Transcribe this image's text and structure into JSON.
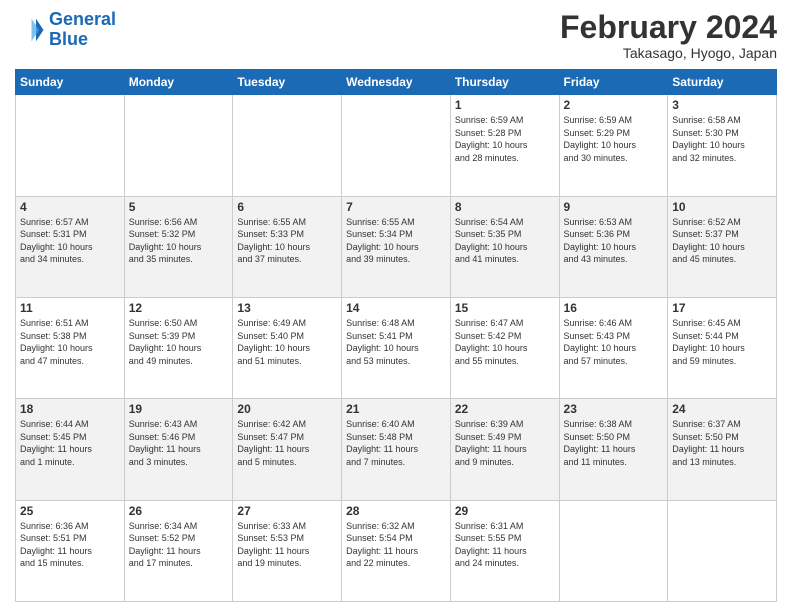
{
  "header": {
    "logo_line1": "General",
    "logo_line2": "Blue",
    "month_title": "February 2024",
    "location": "Takasago, Hyogo, Japan"
  },
  "days_of_week": [
    "Sunday",
    "Monday",
    "Tuesday",
    "Wednesday",
    "Thursday",
    "Friday",
    "Saturday"
  ],
  "weeks": [
    [
      {
        "day": "",
        "info": ""
      },
      {
        "day": "",
        "info": ""
      },
      {
        "day": "",
        "info": ""
      },
      {
        "day": "",
        "info": ""
      },
      {
        "day": "1",
        "info": "Sunrise: 6:59 AM\nSunset: 5:28 PM\nDaylight: 10 hours\nand 28 minutes."
      },
      {
        "day": "2",
        "info": "Sunrise: 6:59 AM\nSunset: 5:29 PM\nDaylight: 10 hours\nand 30 minutes."
      },
      {
        "day": "3",
        "info": "Sunrise: 6:58 AM\nSunset: 5:30 PM\nDaylight: 10 hours\nand 32 minutes."
      }
    ],
    [
      {
        "day": "4",
        "info": "Sunrise: 6:57 AM\nSunset: 5:31 PM\nDaylight: 10 hours\nand 34 minutes."
      },
      {
        "day": "5",
        "info": "Sunrise: 6:56 AM\nSunset: 5:32 PM\nDaylight: 10 hours\nand 35 minutes."
      },
      {
        "day": "6",
        "info": "Sunrise: 6:55 AM\nSunset: 5:33 PM\nDaylight: 10 hours\nand 37 minutes."
      },
      {
        "day": "7",
        "info": "Sunrise: 6:55 AM\nSunset: 5:34 PM\nDaylight: 10 hours\nand 39 minutes."
      },
      {
        "day": "8",
        "info": "Sunrise: 6:54 AM\nSunset: 5:35 PM\nDaylight: 10 hours\nand 41 minutes."
      },
      {
        "day": "9",
        "info": "Sunrise: 6:53 AM\nSunset: 5:36 PM\nDaylight: 10 hours\nand 43 minutes."
      },
      {
        "day": "10",
        "info": "Sunrise: 6:52 AM\nSunset: 5:37 PM\nDaylight: 10 hours\nand 45 minutes."
      }
    ],
    [
      {
        "day": "11",
        "info": "Sunrise: 6:51 AM\nSunset: 5:38 PM\nDaylight: 10 hours\nand 47 minutes."
      },
      {
        "day": "12",
        "info": "Sunrise: 6:50 AM\nSunset: 5:39 PM\nDaylight: 10 hours\nand 49 minutes."
      },
      {
        "day": "13",
        "info": "Sunrise: 6:49 AM\nSunset: 5:40 PM\nDaylight: 10 hours\nand 51 minutes."
      },
      {
        "day": "14",
        "info": "Sunrise: 6:48 AM\nSunset: 5:41 PM\nDaylight: 10 hours\nand 53 minutes."
      },
      {
        "day": "15",
        "info": "Sunrise: 6:47 AM\nSunset: 5:42 PM\nDaylight: 10 hours\nand 55 minutes."
      },
      {
        "day": "16",
        "info": "Sunrise: 6:46 AM\nSunset: 5:43 PM\nDaylight: 10 hours\nand 57 minutes."
      },
      {
        "day": "17",
        "info": "Sunrise: 6:45 AM\nSunset: 5:44 PM\nDaylight: 10 hours\nand 59 minutes."
      }
    ],
    [
      {
        "day": "18",
        "info": "Sunrise: 6:44 AM\nSunset: 5:45 PM\nDaylight: 11 hours\nand 1 minute."
      },
      {
        "day": "19",
        "info": "Sunrise: 6:43 AM\nSunset: 5:46 PM\nDaylight: 11 hours\nand 3 minutes."
      },
      {
        "day": "20",
        "info": "Sunrise: 6:42 AM\nSunset: 5:47 PM\nDaylight: 11 hours\nand 5 minutes."
      },
      {
        "day": "21",
        "info": "Sunrise: 6:40 AM\nSunset: 5:48 PM\nDaylight: 11 hours\nand 7 minutes."
      },
      {
        "day": "22",
        "info": "Sunrise: 6:39 AM\nSunset: 5:49 PM\nDaylight: 11 hours\nand 9 minutes."
      },
      {
        "day": "23",
        "info": "Sunrise: 6:38 AM\nSunset: 5:50 PM\nDaylight: 11 hours\nand 11 minutes."
      },
      {
        "day": "24",
        "info": "Sunrise: 6:37 AM\nSunset: 5:50 PM\nDaylight: 11 hours\nand 13 minutes."
      }
    ],
    [
      {
        "day": "25",
        "info": "Sunrise: 6:36 AM\nSunset: 5:51 PM\nDaylight: 11 hours\nand 15 minutes."
      },
      {
        "day": "26",
        "info": "Sunrise: 6:34 AM\nSunset: 5:52 PM\nDaylight: 11 hours\nand 17 minutes."
      },
      {
        "day": "27",
        "info": "Sunrise: 6:33 AM\nSunset: 5:53 PM\nDaylight: 11 hours\nand 19 minutes."
      },
      {
        "day": "28",
        "info": "Sunrise: 6:32 AM\nSunset: 5:54 PM\nDaylight: 11 hours\nand 22 minutes."
      },
      {
        "day": "29",
        "info": "Sunrise: 6:31 AM\nSunset: 5:55 PM\nDaylight: 11 hours\nand 24 minutes."
      },
      {
        "day": "",
        "info": ""
      },
      {
        "day": "",
        "info": ""
      }
    ]
  ]
}
